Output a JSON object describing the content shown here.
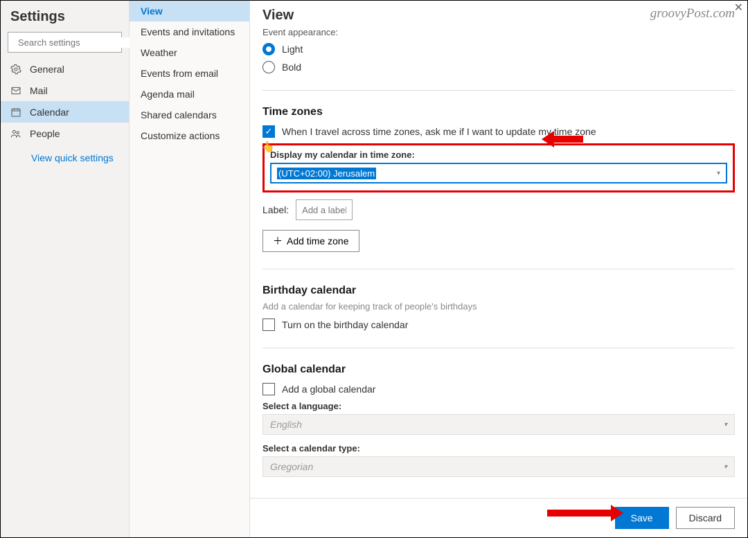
{
  "left": {
    "title": "Settings",
    "search_placeholder": "Search settings",
    "items": [
      {
        "label": "General"
      },
      {
        "label": "Mail"
      },
      {
        "label": "Calendar"
      },
      {
        "label": "People"
      }
    ],
    "quick": "View quick settings"
  },
  "sub": {
    "items": [
      {
        "label": "View"
      },
      {
        "label": "Events and invitations"
      },
      {
        "label": "Weather"
      },
      {
        "label": "Events from email"
      },
      {
        "label": "Agenda mail"
      },
      {
        "label": "Shared calendars"
      },
      {
        "label": "Customize actions"
      }
    ]
  },
  "main": {
    "title": "View",
    "brand": "groovyPost.com",
    "event_appearance": {
      "heading": "Event appearance:",
      "opt_light": "Light",
      "opt_bold": "Bold"
    },
    "timezones": {
      "heading": "Time zones",
      "travel_check": "When I travel across time zones, ask me if I want to update my time zone",
      "display_label": "Display my calendar in time zone:",
      "tz_value": "(UTC+02:00) Jerusalem",
      "label_text": "Label:",
      "label_placeholder": "Add a label",
      "add_btn": "Add time zone"
    },
    "birthday": {
      "heading": "Birthday calendar",
      "desc": "Add a calendar for keeping track of people's birthdays",
      "check": "Turn on the birthday calendar"
    },
    "global": {
      "heading": "Global calendar",
      "check": "Add a global calendar",
      "lang_label": "Select a language:",
      "lang_value": "English",
      "type_label": "Select a calendar type:",
      "type_value": "Gregorian"
    }
  },
  "footer": {
    "save": "Save",
    "discard": "Discard"
  }
}
